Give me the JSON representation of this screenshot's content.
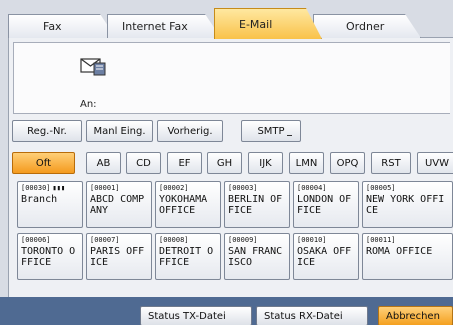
{
  "tabs": [
    {
      "label": "Fax",
      "active": false
    },
    {
      "label": "Internet Fax",
      "active": false
    },
    {
      "label": "E-Mail",
      "active": true
    },
    {
      "label": "Ordner",
      "active": false
    }
  ],
  "destination": {
    "icon": "email-envelope-icon",
    "to_label": "An:"
  },
  "toolbar": {
    "reg_nr": "Reg.-Nr.",
    "manual": "Manl Eing.",
    "previous": "Vorherig.",
    "smtp": "SMTP"
  },
  "index_keys": [
    "Oft",
    "AB",
    "CD",
    "EF",
    "GH",
    "IJK",
    "LMN",
    "OPQ",
    "RST",
    "UVW"
  ],
  "entries": [
    {
      "number": "[00030]",
      "name": "Branch",
      "group": true
    },
    {
      "number": "[00001]",
      "name": "ABCD COMPANY"
    },
    {
      "number": "[00002]",
      "name": "YOKOHAMA OFFICE"
    },
    {
      "number": "[00003]",
      "name": "BERLIN OFFICE"
    },
    {
      "number": "[00004]",
      "name": "LONDON OFFICE"
    },
    {
      "number": "[00005]",
      "name": "NEW YORK OFFICE"
    },
    {
      "number": "[00006]",
      "name": "TORONTO OFFICE"
    },
    {
      "number": "[00007]",
      "name": "PARIS OFFICE"
    },
    {
      "number": "[00008]",
      "name": "DETROIT OFFICE"
    },
    {
      "number": "[00009]",
      "name": "SAN FRANCISCO"
    },
    {
      "number": "[00010]",
      "name": "OSAKA OFFICE"
    },
    {
      "number": "[00011]",
      "name": "ROMA OFFICE"
    }
  ],
  "status": {
    "tx_file": "Status TX-Datei",
    "rx_file": "Status RX-Datei",
    "cancel": "Abbrechen"
  },
  "colors": {
    "active_tab": "#f9c24a",
    "active_index": "#f49a1e",
    "bottom_bar": "#4f6a92"
  }
}
